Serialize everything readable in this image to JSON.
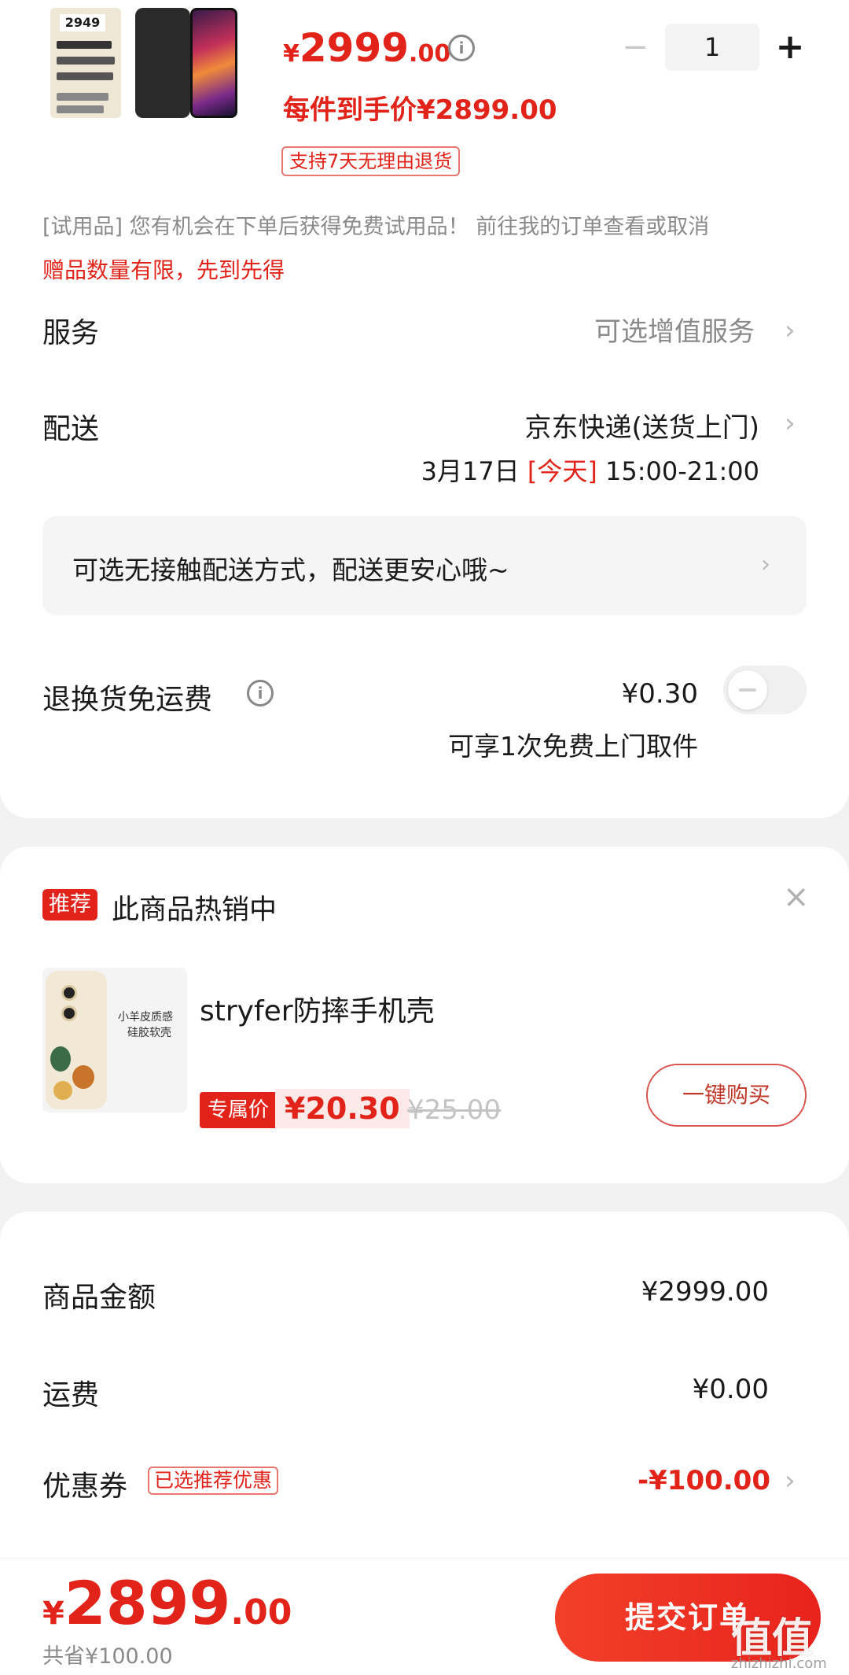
{
  "product": {
    "box_price": "2949",
    "price_symbol": "¥",
    "price_int": "2999",
    "price_dec": ".00",
    "final_price_text": "每件到手价¥2899.00",
    "return_badge": "支持7天无理由退货",
    "quantity": "1"
  },
  "trial_text": "[试用品] 您有机会在下单后获得免费试用品！ 前往我的订单查看或取消",
  "gift_note": "赠品数量有限，先到先得",
  "service": {
    "label": "服务",
    "value": "可选增值服务"
  },
  "delivery": {
    "label": "配送",
    "carrier": "京东快递(送货上门)",
    "date": "3月17日",
    "today": "[今天]",
    "time": "15:00-21:00",
    "contactless": "可选无接触配送方式，配送更安心哦~"
  },
  "return_shipping": {
    "label": "退换货免运费",
    "price": "¥0.30",
    "desc": "可享1次免费上门取件",
    "enabled": false
  },
  "recommend": {
    "badge": "推荐",
    "title": "此商品热销中",
    "case_text_1": "小羊皮质感",
    "case_text_2": "硅胶软壳",
    "item_name": "stryfer防摔手机壳",
    "price_tag": "专属价",
    "price": "¥20.30",
    "orig_price": "¥25.00",
    "buy_label": "一键购买"
  },
  "summary": {
    "goods_label": "商品金额",
    "goods_value": "¥2999.00",
    "shipping_label": "运费",
    "shipping_value": "¥0.00",
    "coupon_label": "优惠券",
    "coupon_badge": "已选推荐优惠",
    "coupon_value": "-¥100.00"
  },
  "footer": {
    "symbol": "¥",
    "total_int": "2899",
    "total_dec": ".00",
    "saved": "共省¥100.00",
    "submit_label": "提交订单"
  },
  "watermark": {
    "logo": "值值值",
    "site": "zhizhizhi.com"
  },
  "colors": {
    "accent": "#e2231a",
    "background": "#f2f2f2"
  }
}
